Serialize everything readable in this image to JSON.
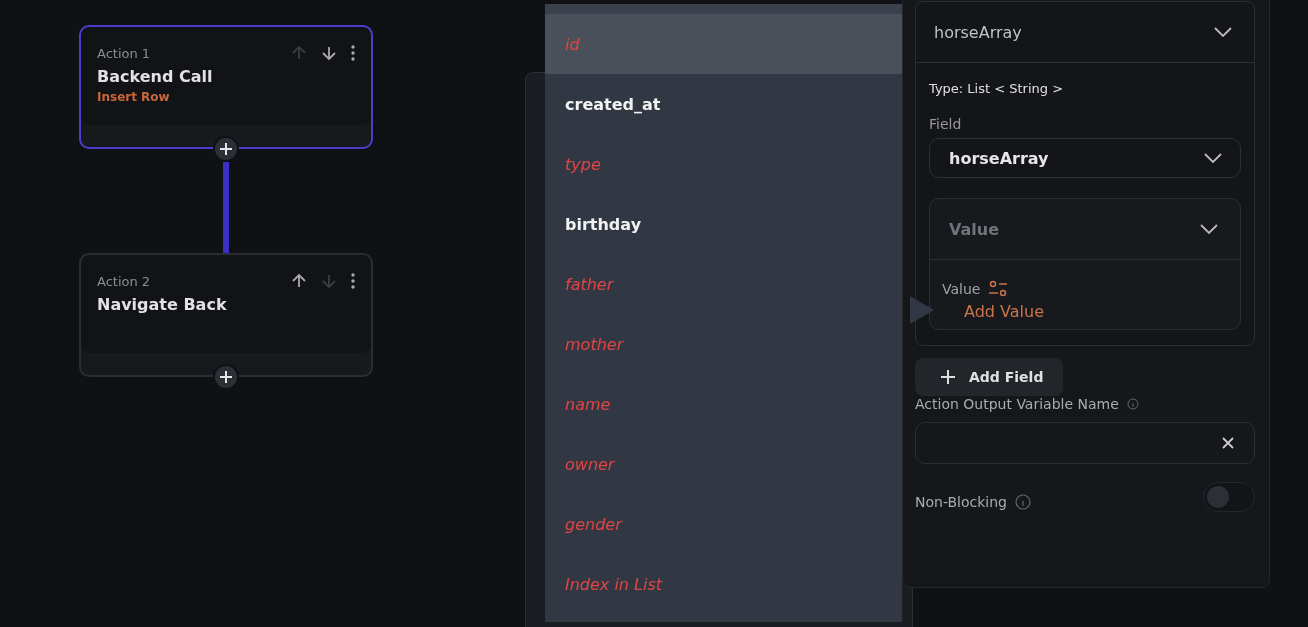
{
  "actions": [
    {
      "label": "Action 1",
      "title": "Backend Call",
      "subtitle": "Insert Row",
      "selected": true,
      "up_enabled": false,
      "down_enabled": true
    },
    {
      "label": "Action 2",
      "title": "Navigate Back",
      "selected": false,
      "up_enabled": true,
      "down_enabled": false
    }
  ],
  "dropdown": {
    "items": [
      {
        "label": "id",
        "enabled": false,
        "selected": true
      },
      {
        "label": "created_at",
        "enabled": true,
        "selected": false
      },
      {
        "label": "type",
        "enabled": false,
        "selected": false
      },
      {
        "label": "birthday",
        "enabled": true,
        "selected": false
      },
      {
        "label": "father",
        "enabled": false,
        "selected": false
      },
      {
        "label": "mother",
        "enabled": false,
        "selected": false
      },
      {
        "label": "name",
        "enabled": false,
        "selected": false
      },
      {
        "label": "owner",
        "enabled": false,
        "selected": false
      },
      {
        "label": "gender",
        "enabled": false,
        "selected": false
      },
      {
        "label": "Index in List",
        "enabled": false,
        "selected": false
      }
    ]
  },
  "panel": {
    "header": "horseArray",
    "type_label": "Type: List < String >",
    "field_label": "Field",
    "field_value": "horseArray",
    "value_header": "Value",
    "value_label": "Value",
    "add_value": "Add Value",
    "add_field": "Add Field",
    "output_label": "Action Output Variable Name",
    "non_blocking_label": "Non-Blocking",
    "non_blocking": false
  }
}
